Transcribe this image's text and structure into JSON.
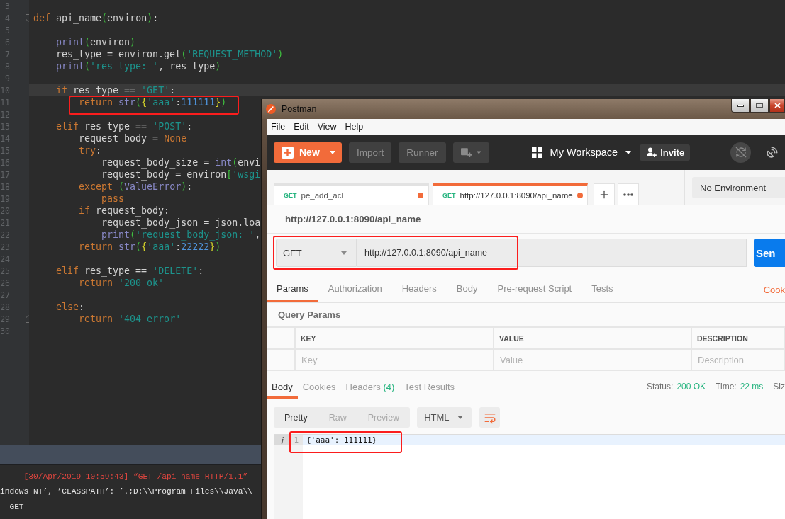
{
  "editor": {
    "lines": [
      {
        "number": "3",
        "kind": "code",
        "current": false
      },
      {
        "number": "4",
        "kind": "fold_start",
        "current": false,
        "tokens": [
          {
            "kind": "keyword",
            "text": "def"
          },
          {
            "kind": "plain",
            "text": " api_name"
          },
          {
            "kind": "paren",
            "text": "("
          },
          {
            "kind": "plain",
            "text": "environ"
          },
          {
            "kind": "paren",
            "text": ")"
          },
          {
            "kind": "plain",
            "text": ":"
          }
        ]
      },
      {
        "number": "5",
        "kind": "code",
        "current": false
      },
      {
        "number": "6",
        "kind": "code",
        "current": false,
        "tokens": [
          {
            "kind": "builtin",
            "text": "    print"
          },
          {
            "kind": "paren",
            "text": "("
          },
          {
            "kind": "plain",
            "text": "environ"
          },
          {
            "kind": "paren",
            "text": ")"
          }
        ]
      },
      {
        "number": "7",
        "kind": "code",
        "current": false,
        "tokens": [
          {
            "kind": "plain",
            "text": "    res_type = environ.get"
          },
          {
            "kind": "paren",
            "text": "("
          },
          {
            "kind": "string",
            "text": "'REQUEST_METHOD'"
          },
          {
            "kind": "paren",
            "text": ")"
          }
        ]
      },
      {
        "number": "8",
        "kind": "code",
        "current": false,
        "tokens": [
          {
            "kind": "builtin",
            "text": "    print"
          },
          {
            "kind": "paren",
            "text": "("
          },
          {
            "kind": "string",
            "text": "'res_type: '"
          },
          {
            "kind": "plain",
            "text": ", res_type"
          },
          {
            "kind": "paren",
            "text": ")"
          }
        ]
      },
      {
        "number": "9",
        "kind": "code",
        "current": false
      },
      {
        "number": "10",
        "kind": "code",
        "current": true,
        "tokens": [
          {
            "kind": "keyword",
            "text": "    if"
          },
          {
            "kind": "plain",
            "text": " res type == "
          },
          {
            "kind": "string",
            "text": "'GET'"
          },
          {
            "kind": "plain",
            "text": ":"
          }
        ]
      },
      {
        "number": "11",
        "kind": "code",
        "current": false,
        "tokens": [
          {
            "kind": "keyword",
            "text": "        return "
          },
          {
            "kind": "builtin",
            "text": "str"
          },
          {
            "kind": "paren",
            "text": "("
          },
          {
            "kind": "brace",
            "text": "{"
          },
          {
            "kind": "string",
            "text": "'aaa'"
          },
          {
            "kind": "plain",
            "text": ":"
          },
          {
            "kind": "number",
            "text": "111111"
          },
          {
            "kind": "brace",
            "text": "}"
          },
          {
            "kind": "paren",
            "text": ")"
          }
        ]
      },
      {
        "number": "12",
        "kind": "code",
        "current": false
      },
      {
        "number": "13",
        "kind": "code",
        "current": false,
        "tokens": [
          {
            "kind": "keyword",
            "text": "    elif"
          },
          {
            "kind": "plain",
            "text": " res_type == "
          },
          {
            "kind": "string",
            "text": "'POST'"
          },
          {
            "kind": "plain",
            "text": ":"
          }
        ]
      },
      {
        "number": "14",
        "kind": "code",
        "current": false,
        "tokens": [
          {
            "kind": "plain",
            "text": "        request_body = "
          },
          {
            "kind": "keyword",
            "text": "None"
          }
        ]
      },
      {
        "number": "15",
        "kind": "code",
        "current": false,
        "tokens": [
          {
            "kind": "keyword",
            "text": "        try"
          },
          {
            "kind": "plain",
            "text": ":"
          }
        ]
      },
      {
        "number": "16",
        "kind": "code",
        "current": false,
        "tokens": [
          {
            "kind": "plain",
            "text": "            request_body_size = "
          },
          {
            "kind": "builtin",
            "text": "int"
          },
          {
            "kind": "paren",
            "text": "("
          },
          {
            "kind": "plain",
            "text": "envi"
          }
        ]
      },
      {
        "number": "17",
        "kind": "code",
        "current": false,
        "tokens": [
          {
            "kind": "plain",
            "text": "            request_body = environ"
          },
          {
            "kind": "paren",
            "text": "["
          },
          {
            "kind": "string",
            "text": "'wsgi"
          }
        ]
      },
      {
        "number": "18",
        "kind": "code",
        "current": false,
        "tokens": [
          {
            "kind": "keyword",
            "text": "        except "
          },
          {
            "kind": "paren",
            "text": "("
          },
          {
            "kind": "builtin",
            "text": "ValueError"
          },
          {
            "kind": "paren",
            "text": ")"
          },
          {
            "kind": "plain",
            "text": ":"
          }
        ]
      },
      {
        "number": "19",
        "kind": "code",
        "current": false,
        "tokens": [
          {
            "kind": "keyword",
            "text": "            pass"
          }
        ]
      },
      {
        "number": "20",
        "kind": "code",
        "current": false,
        "tokens": [
          {
            "kind": "keyword",
            "text": "        if"
          },
          {
            "kind": "plain",
            "text": " request_body:"
          }
        ]
      },
      {
        "number": "21",
        "kind": "code",
        "current": false,
        "tokens": [
          {
            "kind": "plain",
            "text": "            request_body_json = json.loa"
          }
        ]
      },
      {
        "number": "22",
        "kind": "code",
        "current": false,
        "tokens": [
          {
            "kind": "builtin",
            "text": "            print"
          },
          {
            "kind": "paren",
            "text": "("
          },
          {
            "kind": "string",
            "text": "'request_body_json: '"
          },
          {
            "kind": "plain",
            "text": ","
          }
        ]
      },
      {
        "number": "23",
        "kind": "code",
        "current": false,
        "tokens": [
          {
            "kind": "keyword",
            "text": "        return "
          },
          {
            "kind": "builtin",
            "text": "str"
          },
          {
            "kind": "paren",
            "text": "("
          },
          {
            "kind": "brace",
            "text": "{"
          },
          {
            "kind": "string",
            "text": "'aaa'"
          },
          {
            "kind": "plain",
            "text": ":"
          },
          {
            "kind": "number",
            "text": "22222"
          },
          {
            "kind": "brace",
            "text": "}"
          },
          {
            "kind": "paren",
            "text": ")"
          }
        ]
      },
      {
        "number": "24",
        "kind": "code",
        "current": false
      },
      {
        "number": "25",
        "kind": "code",
        "current": false,
        "tokens": [
          {
            "kind": "keyword",
            "text": "    elif"
          },
          {
            "kind": "plain",
            "text": " res_type == "
          },
          {
            "kind": "string",
            "text": "'DELETE'"
          },
          {
            "kind": "plain",
            "text": ":"
          }
        ]
      },
      {
        "number": "26",
        "kind": "code",
        "current": false,
        "tokens": [
          {
            "kind": "keyword",
            "text": "        return "
          },
          {
            "kind": "string",
            "text": "'200 ok'"
          }
        ]
      },
      {
        "number": "27",
        "kind": "code",
        "current": false
      },
      {
        "number": "28",
        "kind": "code",
        "current": false,
        "tokens": [
          {
            "kind": "keyword",
            "text": "    else"
          },
          {
            "kind": "plain",
            "text": ":"
          }
        ]
      },
      {
        "number": "29",
        "kind": "fold_end",
        "current": false,
        "tokens": [
          {
            "kind": "keyword",
            "text": "        return "
          },
          {
            "kind": "string",
            "text": "'404 error'"
          }
        ]
      },
      {
        "number": "30",
        "kind": "code",
        "current": false
      }
    ]
  },
  "console": {
    "lines": [
      {
        "kind": "error",
        "text": " - - [30/Apr/2019 10:59:43] “GET /api_name HTTP/1.1”"
      },
      {
        "kind": "output",
        "text": "indows_NT’, ’CLASSPATH’: ’.;D:\\\\Program Files\\\\Java\\\\"
      },
      {
        "kind": "output",
        "text": "  GET"
      }
    ]
  },
  "postman": {
    "window_title": "Postman",
    "menu": [
      "File",
      "Edit",
      "View",
      "Help"
    ],
    "header": {
      "new_label": "New",
      "actions": [
        "Import",
        "Runner"
      ],
      "workspace": "My Workspace",
      "invite": "Invite"
    },
    "tabs": [
      {
        "method": "GET",
        "title": "pe_add_acl",
        "selected": false,
        "unsaved": true
      },
      {
        "method": "GET",
        "title": "http://127.0.0.1:8090/api_name",
        "selected": true,
        "unsaved": true
      }
    ],
    "environment": "No Environment",
    "request": {
      "title": "http://127.0.0.1:8090/api_name",
      "method": "GET",
      "url": "http://127.0.0.1:8090/api_name",
      "send_label": "Sen"
    },
    "request_tabs": [
      {
        "label": "Params",
        "selected": true
      },
      {
        "label": "Authorization",
        "selected": false
      },
      {
        "label": "Headers",
        "selected": false
      },
      {
        "label": "Body",
        "selected": false
      },
      {
        "label": "Pre-request Script",
        "selected": false
      },
      {
        "label": "Tests",
        "selected": false
      }
    ],
    "cookies_link": "Cook",
    "query_params": {
      "title": "Query Params",
      "columns": [
        "KEY",
        "VALUE",
        "DESCRIPTION"
      ],
      "placeholders": [
        "Key",
        "Value",
        "Description"
      ]
    },
    "response": {
      "tabs": [
        {
          "label": "Body",
          "selected": true
        },
        {
          "label": "Cookies",
          "selected": false
        },
        {
          "label": "Headers",
          "count": "(4)",
          "selected": false
        },
        {
          "label": "Test Results",
          "selected": false
        }
      ],
      "meta": [
        {
          "label": "Status:",
          "value": "200 OK"
        },
        {
          "label": "Time:",
          "value": "22 ms"
        },
        {
          "label": "Siz"
        }
      ],
      "view_modes": [
        {
          "label": "Pretty",
          "selected": true
        },
        {
          "label": "Raw",
          "selected": false
        },
        {
          "label": "Preview",
          "selected": false
        }
      ],
      "format": "HTML",
      "lines": [
        {
          "number": "1",
          "text": "{'aaa': 111111}",
          "current": true
        }
      ]
    }
  }
}
